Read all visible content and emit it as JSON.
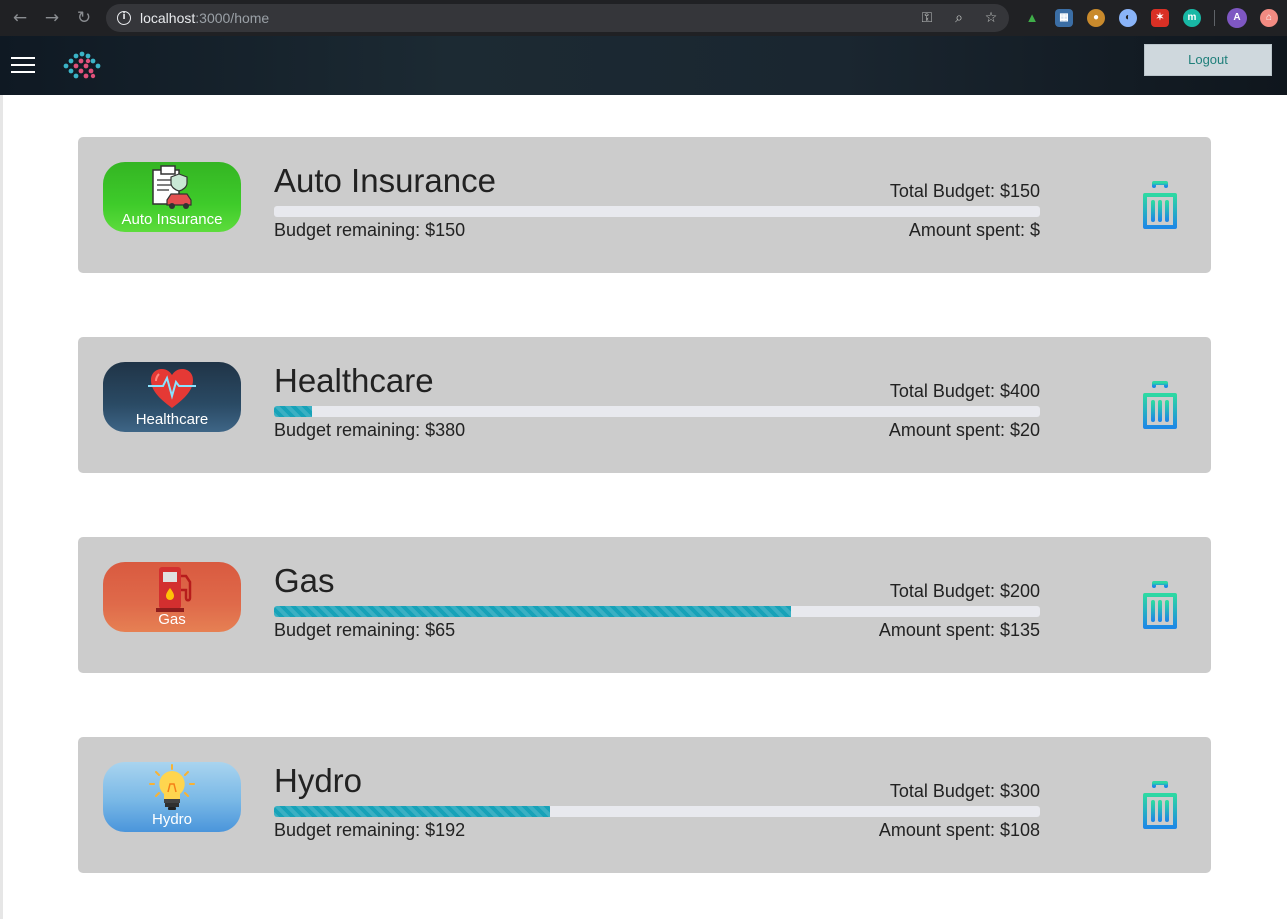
{
  "browser": {
    "url_host": "localhost",
    "url_path": ":3000/home",
    "profile_initial": "A",
    "extension_m_label": "m"
  },
  "header": {
    "logout_label": "Logout"
  },
  "colors": {
    "progress_fill": "#17a2b8",
    "card_background": "#cccccc",
    "trash_top": "#2ed8a3",
    "trash_bottom": "#1e88e5"
  },
  "budgets": [
    {
      "title": "Auto Insurance",
      "badge_label": "Auto Insurance",
      "badge_icon": "insurance-document-car-icon",
      "total_budget": "Total Budget: $150",
      "remaining": "Budget remaining: $150",
      "spent": "Amount spent: $",
      "progress": 0
    },
    {
      "title": "Healthcare",
      "badge_label": "Healthcare",
      "badge_icon": "heart-pulse-icon",
      "total_budget": "Total Budget: $400",
      "remaining": "Budget remaining: $380",
      "spent": "Amount spent: $20",
      "progress": 0.05
    },
    {
      "title": "Gas",
      "badge_label": "Gas",
      "badge_icon": "fuel-pump-icon",
      "total_budget": "Total Budget: $200",
      "remaining": "Budget remaining: $65",
      "spent": "Amount spent: $135",
      "progress": 0.675
    },
    {
      "title": "Hydro",
      "badge_label": "Hydro",
      "badge_icon": "light-bulb-icon",
      "total_budget": "Total Budget: $300",
      "remaining": "Budget remaining: $192",
      "spent": "Amount spent: $108",
      "progress": 0.36
    }
  ]
}
